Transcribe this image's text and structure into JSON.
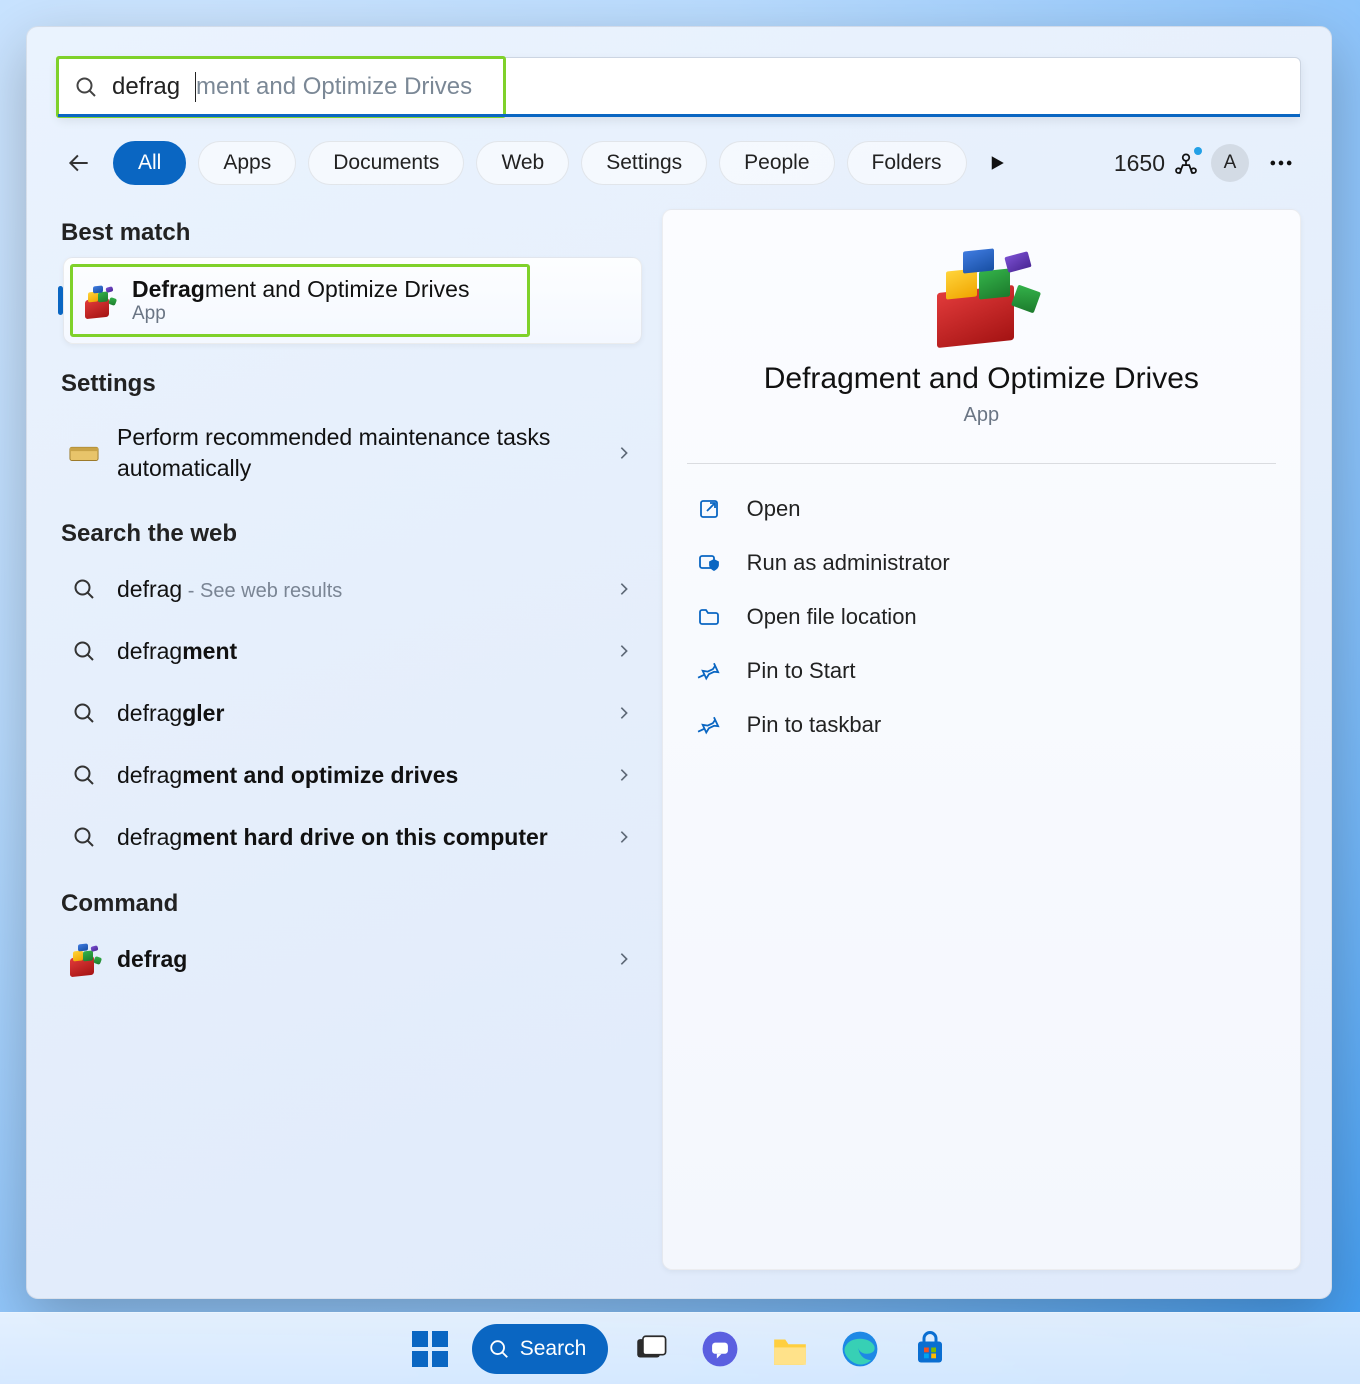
{
  "search": {
    "typed": "defrag",
    "ghost": "ment and Optimize Drives"
  },
  "filters": {
    "tabs": [
      "All",
      "Apps",
      "Documents",
      "Web",
      "Settings",
      "People",
      "Folders"
    ],
    "active_index": 0,
    "points": "1650",
    "avatar": "A"
  },
  "left": {
    "best_match_header": "Best match",
    "best": {
      "title_bold": "Defrag",
      "title_rest": "ment and Optimize Drives",
      "subtitle": "App"
    },
    "settings_header": "Settings",
    "settings_items": [
      {
        "label": "Perform recommended maintenance tasks automatically"
      }
    ],
    "web_header": "Search the web",
    "web_items": [
      {
        "pre": "defrag",
        "bold": "",
        "hint": " - See web results"
      },
      {
        "pre": "defrag",
        "bold": "ment",
        "hint": ""
      },
      {
        "pre": "defrag",
        "bold": "gler",
        "hint": ""
      },
      {
        "pre": "defrag",
        "bold": "ment and optimize drives",
        "hint": ""
      },
      {
        "pre": "defrag",
        "bold": "ment hard drive on this computer",
        "hint": ""
      }
    ],
    "command_header": "Command",
    "command_items": [
      {
        "label": "defrag"
      }
    ]
  },
  "right": {
    "title": "Defragment and Optimize Drives",
    "subtitle": "App",
    "actions": [
      {
        "icon": "open",
        "label": "Open"
      },
      {
        "icon": "admin",
        "label": "Run as administrator"
      },
      {
        "icon": "folder",
        "label": "Open file location"
      },
      {
        "icon": "pin",
        "label": "Pin to Start"
      },
      {
        "icon": "pin",
        "label": "Pin to taskbar"
      }
    ]
  },
  "taskbar": {
    "search_label": "Search"
  }
}
